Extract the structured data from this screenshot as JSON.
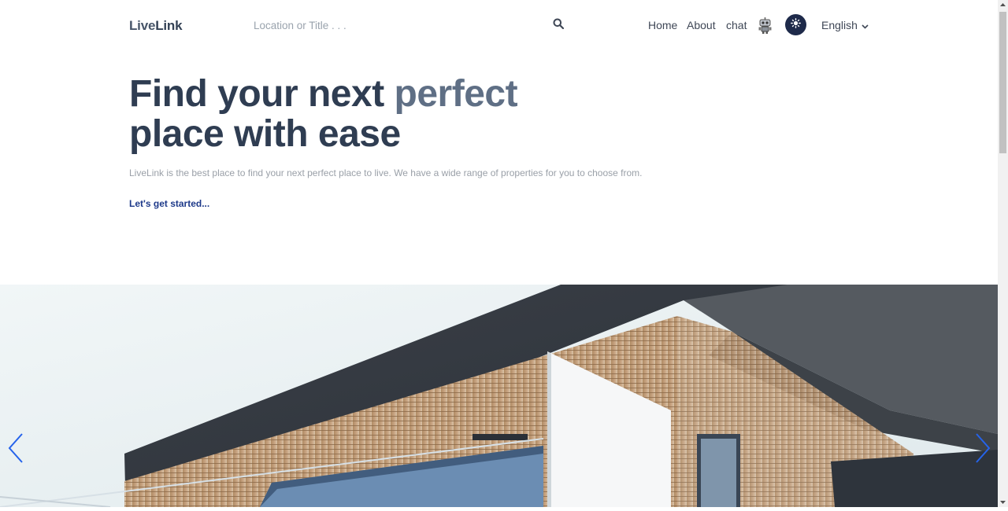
{
  "header": {
    "brand_prefix": "Live",
    "brand_suffix": "Link",
    "search_placeholder": "Location or Title . . .",
    "nav": {
      "home": "Home",
      "about": "About",
      "chat": "chat"
    },
    "language": "English"
  },
  "hero": {
    "title_part1": "Find your next ",
    "title_accent": "perfect",
    "title_part2": "place with ease",
    "description": "LiveLink is the best place to find your next perfect place to live. We have a wide range of properties for you to choose from.",
    "cta": "Let's get started..."
  },
  "colors": {
    "heading": "#2f3d52",
    "accent": "#5f6f85",
    "cta": "#1e3a8a",
    "theme_button": "#1e2a4a",
    "carousel_arrow": "#2563eb"
  },
  "icons": {
    "search": "search-icon",
    "robot": "robot-icon",
    "theme": "sun-icon",
    "language": "chevron-down-icon",
    "carousel_prev": "chevron-left-icon",
    "carousel_next": "chevron-right-icon"
  }
}
